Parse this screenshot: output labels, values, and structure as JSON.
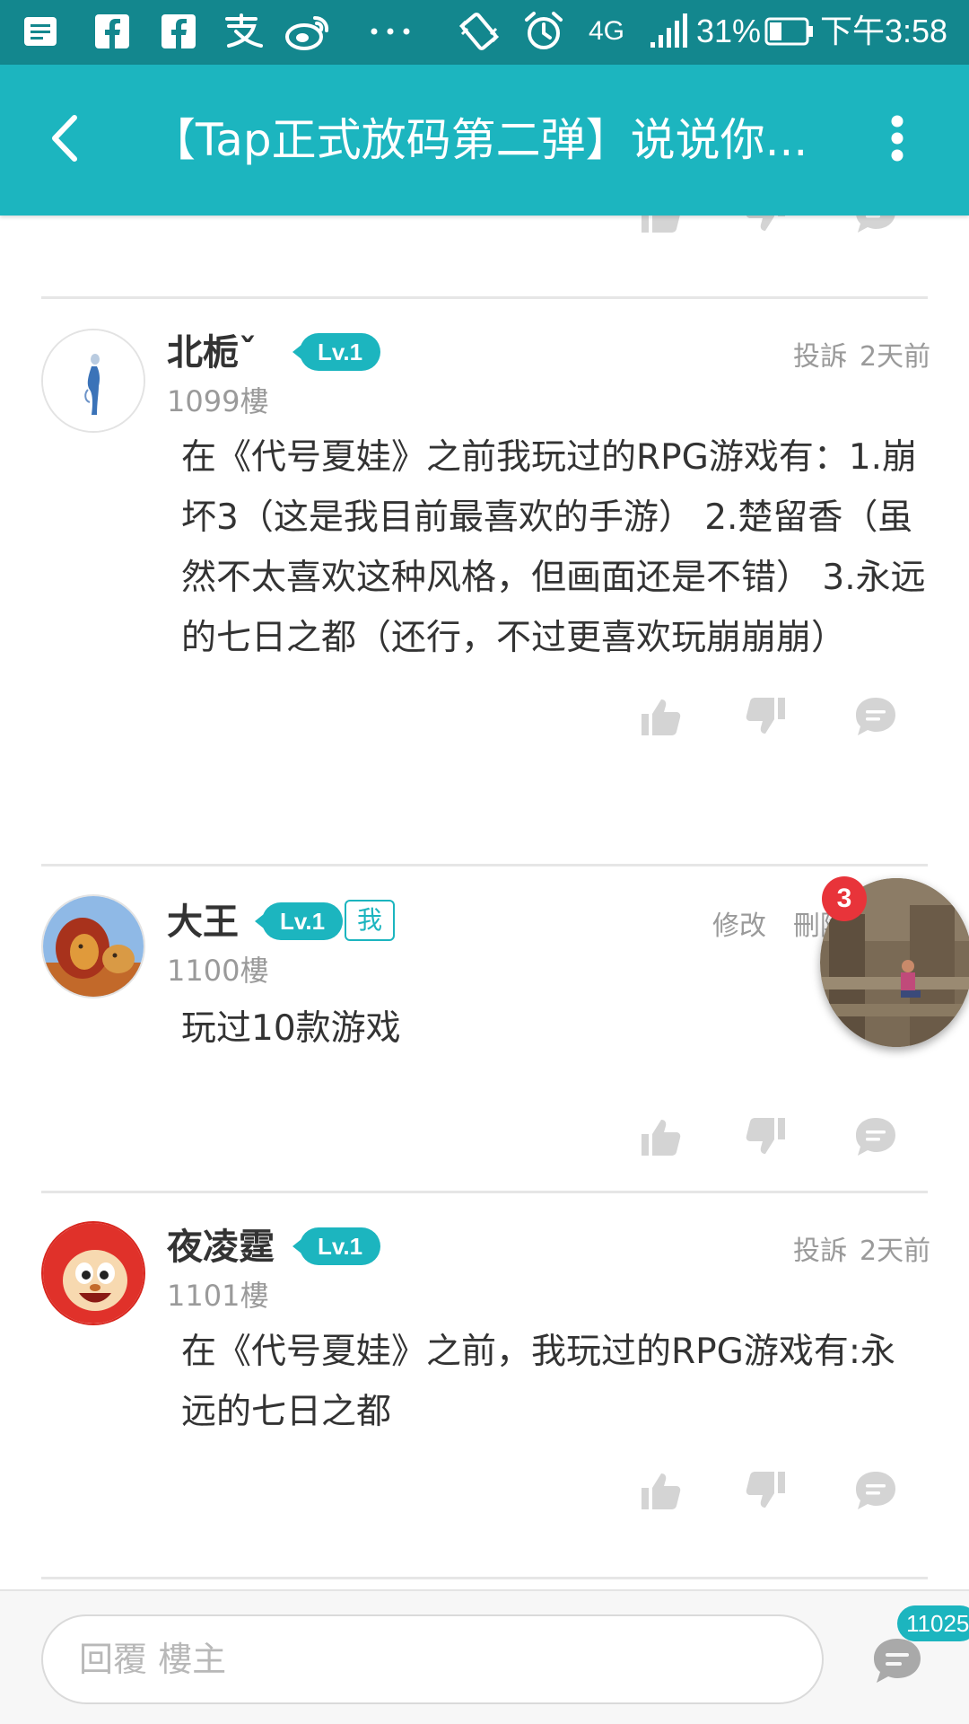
{
  "status_bar": {
    "time": "下午3:58",
    "battery": "31%",
    "network": "4G",
    "icons": [
      "news-icon",
      "facebook-icon",
      "facebook-icon",
      "alipay-icon",
      "weibo-icon",
      "more-dots-icon",
      "vibrate-icon",
      "alarm-icon",
      "signal-icon",
      "battery-icon"
    ]
  },
  "app_bar": {
    "title": "【Tap正式放码第二弹】说说你..."
  },
  "comments": [
    {
      "username": "北栀ˇ",
      "level": "Lv.1",
      "floor": "1099樓",
      "report_label": "投訴",
      "time": "2天前",
      "content": "在《代号夏娃》之前我玩过的RPG游戏有：1.崩坏3（这是我目前最喜欢的手游） 2.楚留香（虽然不太喜欢这种风格，但画面还是不错） 3.永远的七日之都（还行，不过更喜欢玩崩崩崩）"
    },
    {
      "username": "大王",
      "level": "Lv.1",
      "me_badge": "我",
      "floor": "1100樓",
      "edit_label": "修改",
      "delete_label": "刪除",
      "content": "玩过10款游戏"
    },
    {
      "username": "夜凌霆",
      "level": "Lv.1",
      "floor": "1101樓",
      "report_label": "投訴",
      "time": "2天前",
      "content": "在《代号夏娃》之前，我玩过的RPG游戏有:永远的七日之都"
    }
  ],
  "floating_bubble": {
    "badge": "3"
  },
  "bottom_bar": {
    "reply_placeholder": "回覆  樓主",
    "comment_count": "11025"
  },
  "colors": {
    "status_bar": "#13878e",
    "app_bar": "#1cb5bf",
    "accent": "#1cb5bf",
    "badge_red": "#e8343a",
    "text_primary": "#333333",
    "text_secondary": "#9a9a9a",
    "icon_gray": "#d0d0d0"
  }
}
